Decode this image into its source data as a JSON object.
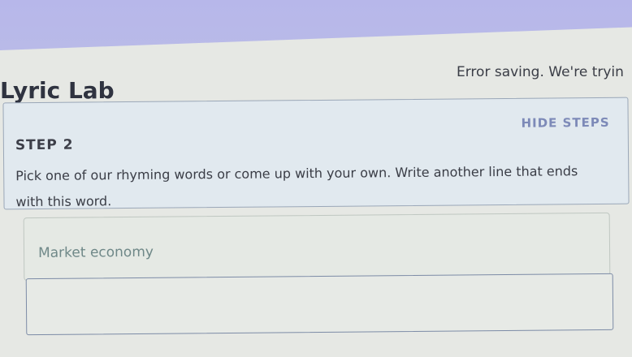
{
  "app": {
    "title": "Lyric Lab"
  },
  "status": {
    "error_text": "Error saving. We're tryin"
  },
  "step": {
    "label": "STEP 2",
    "hide_steps_label": "HIDE STEPS",
    "instructions": "Pick one of our rhyming words or come up with your own. Write another line that ends with this word."
  },
  "rhyme_word": {
    "value": "Market economy"
  },
  "line_input": {
    "value": "",
    "placeholder": ""
  },
  "colors": {
    "header_band": "#b7b7ea",
    "panel_bg": "#e1e9ef",
    "panel_border": "#9aa7b8",
    "hide_steps": "#7d8ab8",
    "word_text": "#6f8888",
    "input_border": "#7c8ba6"
  }
}
